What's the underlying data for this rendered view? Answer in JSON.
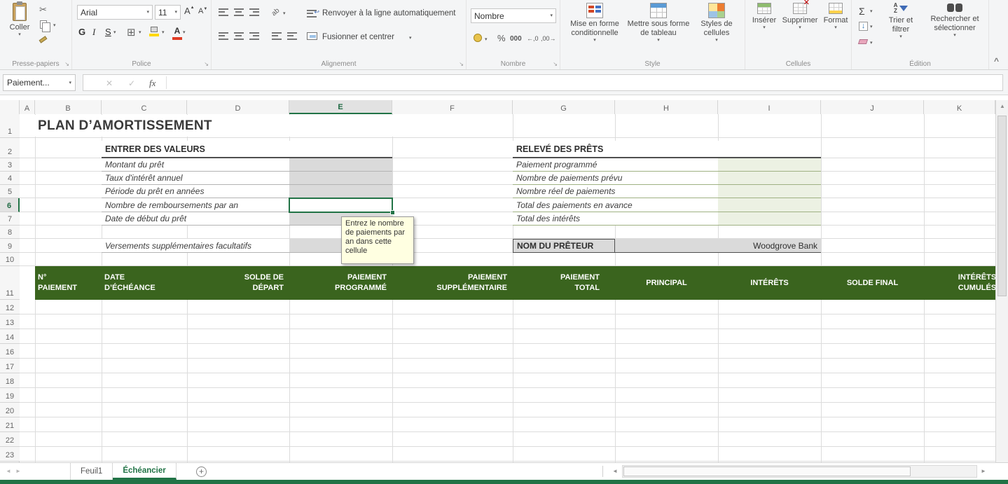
{
  "app": {
    "accent": "#217346",
    "band_green": "#3a641e"
  },
  "ribbon": {
    "clipboard": {
      "label": "Presse-papiers",
      "paste": "Coller"
    },
    "font": {
      "label": "Police",
      "name": "Arial",
      "size": "11",
      "bold": "G",
      "italic": "I",
      "underline": "S"
    },
    "alignment": {
      "label": "Alignement",
      "wrap": "Renvoyer à la ligne automatiquement",
      "merge": "Fusionner et centrer"
    },
    "number": {
      "label": "Nombre",
      "format": "Nombre",
      "percent": "%",
      "thousands": "000"
    },
    "style": {
      "label": "Style",
      "conditional": "Mise en forme conditionnelle",
      "as_table": "Mettre sous forme de tableau",
      "cell_styles": "Styles de cellules"
    },
    "cells": {
      "label": "Cellules",
      "insert": "Insérer",
      "del": "Supprimer",
      "format": "Format"
    },
    "editing": {
      "label": "Édition",
      "sort": "Trier et filtrer",
      "find": "Rechercher et sélectionner"
    }
  },
  "formula_bar": {
    "name_box": "Paiement...",
    "fx": "fx",
    "value": ""
  },
  "grid": {
    "columns": [
      "A",
      "B",
      "C",
      "D",
      "E",
      "F",
      "G",
      "H",
      "I",
      "J",
      "K"
    ],
    "rows": [
      "1",
      "2",
      "3",
      "4",
      "5",
      "6",
      "7",
      "8",
      "9",
      "10",
      "11",
      "12",
      "13",
      "14",
      "16",
      "17",
      "18",
      "19",
      "20",
      "21",
      "22",
      "23"
    ],
    "selected_cell_column": "E",
    "selected_cell_row": "6"
  },
  "sheet": {
    "title": "PLAN D’AMORTISSEMENT",
    "enter_values": {
      "heading": "ENTRER DES VALEURS",
      "labels": [
        "Montant du prêt",
        "Taux d'intérêt annuel",
        "Période du prêt en années",
        "Nombre de remboursements par an",
        "Date de début du prêt"
      ],
      "optional_label": "Versements supplémentaires facultatifs"
    },
    "loan_summary": {
      "heading": "RELEVÉ DES PRÊTS",
      "labels": [
        "Paiement programmé",
        "Nombre de paiements prévu",
        "Nombre réel de paiements",
        "Total des paiements en avance",
        "Total des intérêts"
      ],
      "lender_label": "NOM DU PRÊTEUR",
      "lender_value": "Woodgrove Bank"
    },
    "table_headers": [
      "N°\nPAIEMENT",
      "DATE\nD’ÉCHÉANCE",
      "SOLDE DE\nDÉPART",
      "PAIEMENT\nPROGRAMMÉ",
      "PAIEMENT\nSUPPLÉMENTAIRE",
      "PAIEMENT\nTOTAL",
      "PRINCIPAL",
      "INTÉRÊTS",
      "SOLDE FINAL",
      "INTÉRÊTS\nCUMULÉS"
    ],
    "tooltip": "Entrez le nombre de paiements par an dans cette cellule"
  },
  "tabs": {
    "items": [
      "Feuil1",
      "Échéancier"
    ],
    "active": "Échéancier",
    "add": "+"
  },
  "icons": {
    "dropdown": "▾",
    "cut": "✂",
    "borders": "⊞",
    "grow_font": "A",
    "grow_arrow": "▲",
    "shrink_font": "A",
    "shrink_arrow": "▼",
    "wrap_return": "↩",
    "orientation": "ab",
    "increase_decimal": "←,0",
    "decrease_decimal": ",00→",
    "sum": "Σ",
    "fill_down": "↓",
    "font_color_letter": "A",
    "cancel": "✕",
    "enter": "✓",
    "dialog_launcher": "↘",
    "collapse_ribbon": "^",
    "scroll_up": "▲",
    "tab_prev": "◄",
    "tab_next": "►",
    "scroll_left": "◄",
    "scroll_right": "►",
    "sort_az": "A\nZ"
  }
}
